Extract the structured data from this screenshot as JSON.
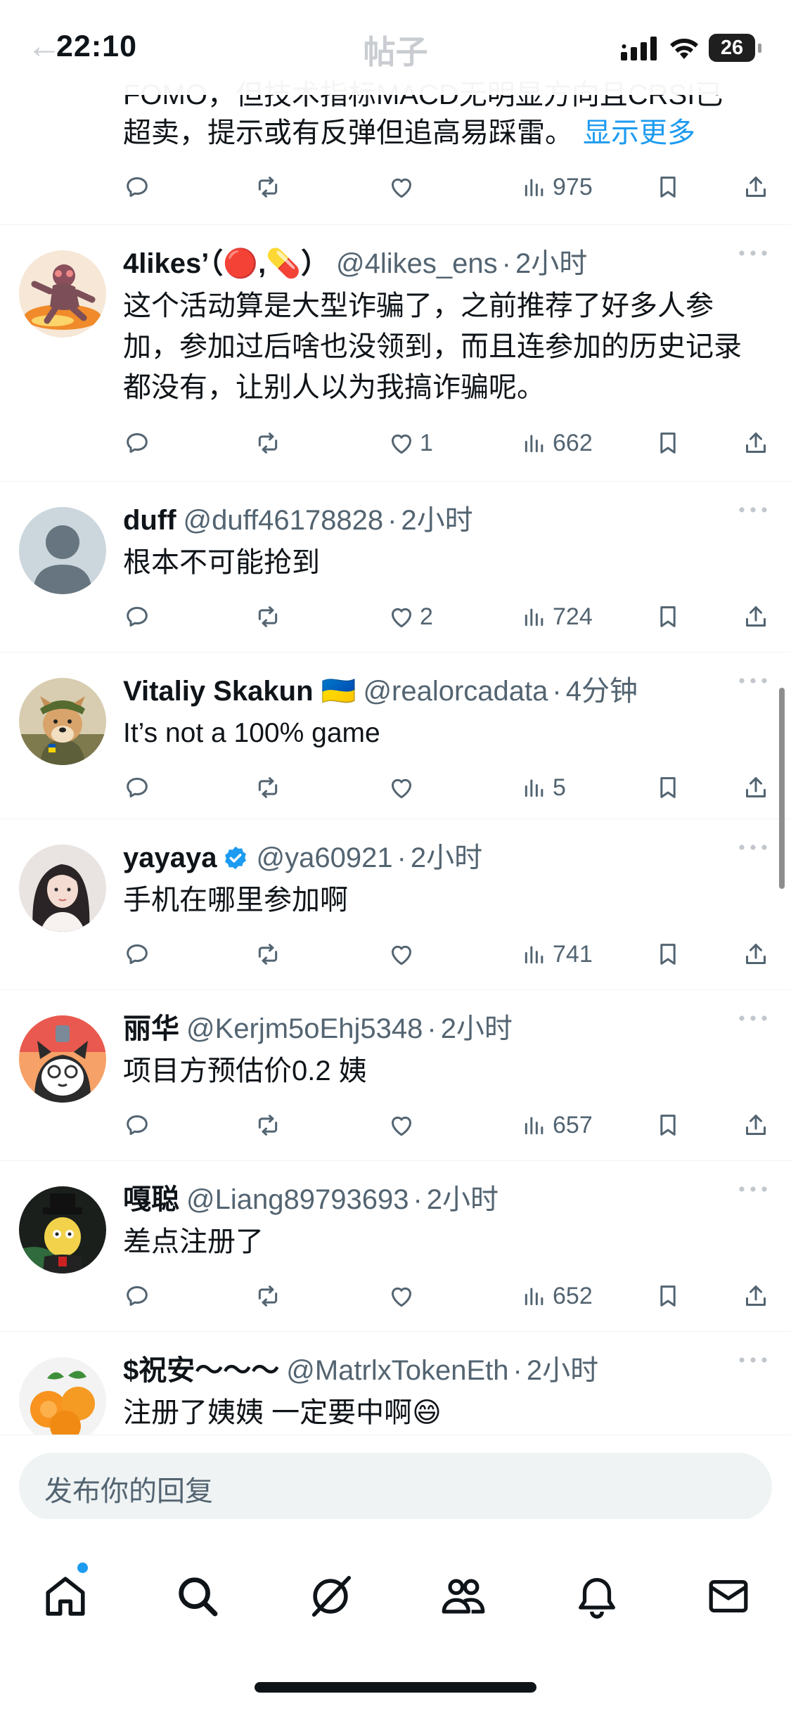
{
  "status_bar": {
    "time": "22:10",
    "battery": "26",
    "icons": [
      "cellular-signal-icon",
      "wifi-icon",
      "battery-icon"
    ]
  },
  "header": {
    "title": "帖子",
    "back_icon": "back-arrow-icon"
  },
  "top_post": {
    "cut_text": "FOMO，但技术指标MACD无明显方向且CRSI已",
    "text": "超卖，提示或有反弹但追高易踩雷。",
    "show_more": "显示更多",
    "actions": {
      "reply": "",
      "repost": "",
      "like": "",
      "views": "975"
    }
  },
  "replies": [
    {
      "name": "4likes’（🔴,💊）",
      "handle": "@4likes_ens",
      "time": "2小时",
      "text": "这个活动算是大型诈骗了，之前推荐了好多人参加，参加过后啥也没领到，而且连参加的历史记录都没有，让别人以为我搞诈骗呢。",
      "actions": {
        "reply": "",
        "repost": "",
        "like": "1",
        "views": "662"
      }
    },
    {
      "name": "duff",
      "handle": "@duff46178828",
      "time": "2小时",
      "text": "根本不可能抢到",
      "actions": {
        "reply": "",
        "repost": "",
        "like": "2",
        "views": "724"
      }
    },
    {
      "name": "Vitaliy Skakun 🇺🇦",
      "handle": "@realorcadata",
      "time": "4分钟",
      "text": "It’s not a 100% game",
      "actions": {
        "reply": "",
        "repost": "",
        "like": "",
        "views": "5"
      }
    },
    {
      "name": "yayaya",
      "handle": "@ya60921",
      "time": "2小时",
      "text": "手机在哪里参加啊",
      "verified": true,
      "actions": {
        "reply": "",
        "repost": "",
        "like": "",
        "views": "741"
      }
    },
    {
      "name": "丽华",
      "handle": "@Kerjm5oEhj5348",
      "time": "2小时",
      "text": "项目方预估价0.2 姨",
      "actions": {
        "reply": "",
        "repost": "",
        "like": "",
        "views": "657"
      }
    },
    {
      "name": "嘎聪",
      "handle": "@Liang89793693",
      "time": "2小时",
      "text": "差点注册了",
      "actions": {
        "reply": "",
        "repost": "",
        "like": "",
        "views": "652"
      }
    },
    {
      "name": "$祝安～～～",
      "handle": "@MatrlxTokenEth",
      "time": "2小时",
      "text": "注册了姨姨 一定要中啊😄"
    }
  ],
  "composer": {
    "placeholder": "发布你的回复"
  },
  "bottom_nav": {
    "items": [
      "home-icon",
      "search-icon",
      "grok-icon",
      "communities-icon",
      "notifications-icon",
      "messages-icon"
    ]
  },
  "colors": {
    "accent": "#1d9bf0",
    "text_primary": "#0f1419",
    "text_secondary": "#536471",
    "divider": "#eff3f4"
  }
}
